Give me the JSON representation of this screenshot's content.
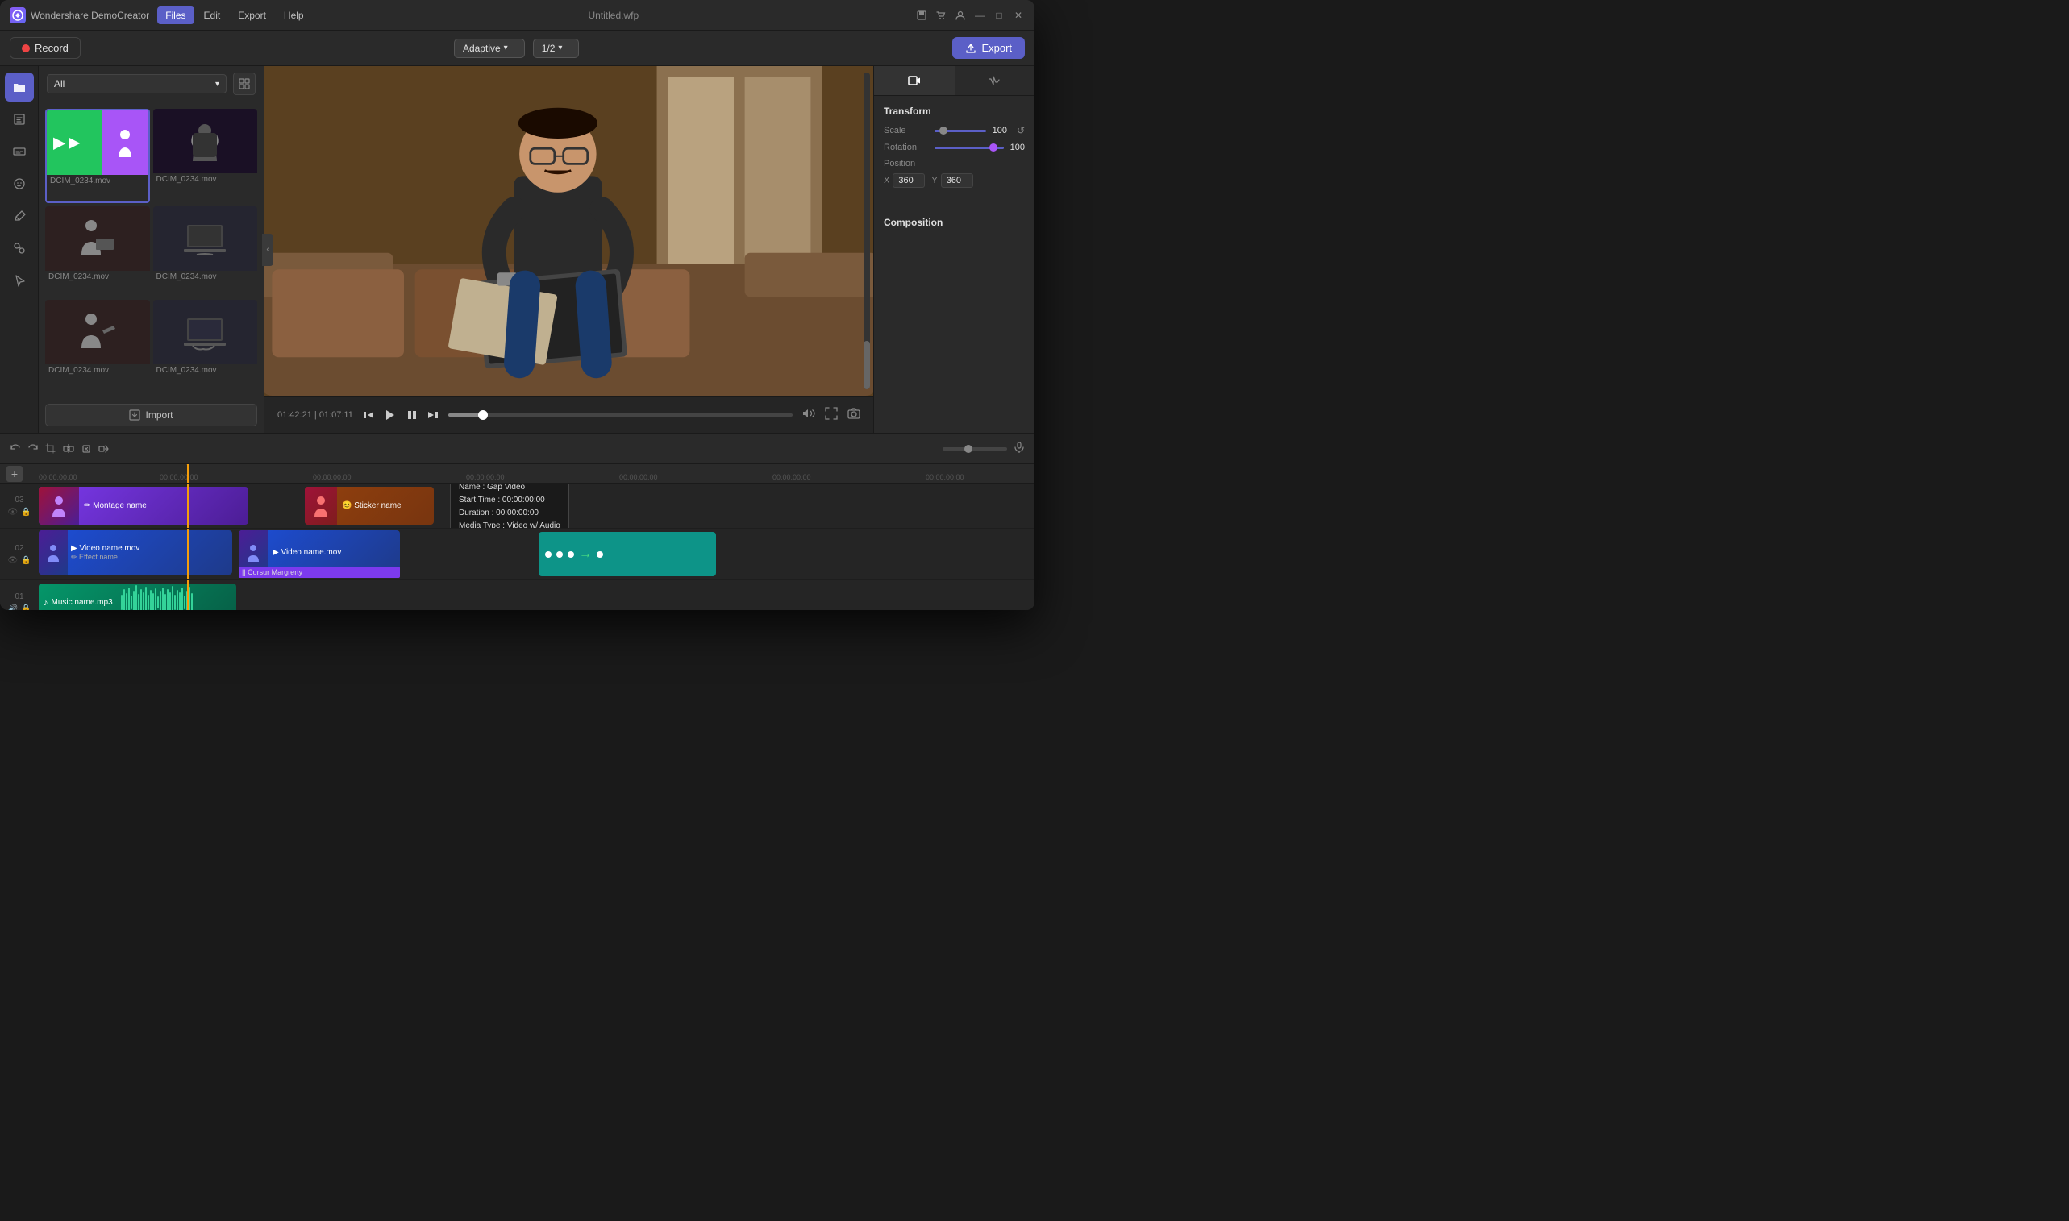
{
  "app": {
    "name": "Wondershare DemoCreator",
    "title": "Untitled.wfp",
    "logo_char": "w"
  },
  "menu": {
    "items": [
      "Files",
      "Edit",
      "Export",
      "Help"
    ],
    "active": "Files"
  },
  "toolbar": {
    "record_label": "Record",
    "quality_label": "Adaptive",
    "ratio_label": "1/2",
    "export_label": "Export"
  },
  "media_panel": {
    "filter_label": "All",
    "items": [
      {
        "name": "DCIM_0234.mov",
        "type": "green_person"
      },
      {
        "name": "DCIM_0234.mov",
        "type": "dark_laptop"
      },
      {
        "name": "DCIM_0234.mov",
        "type": "person_writing"
      },
      {
        "name": "DCIM_0234.mov",
        "type": "laptop_hands"
      },
      {
        "name": "DCIM_0234.mov",
        "type": "person_writing2"
      },
      {
        "name": "DCIM_0234.mov",
        "type": "laptop_hands2"
      }
    ],
    "import_label": "Import"
  },
  "playback": {
    "current_time": "01:42:21",
    "total_time": "01:07:11"
  },
  "right_panel": {
    "transform_title": "Transform",
    "scale_label": "Scale",
    "scale_value": "100",
    "rotation_label": "Rotation",
    "rotation_value": "100",
    "position_label": "Position",
    "x_label": "X",
    "x_value": "360",
    "y_label": "Y",
    "y_value": "360",
    "composition_title": "Composition"
  },
  "timeline": {
    "tracks": [
      {
        "id": "03",
        "clips": [
          {
            "label": "✏ Montage name",
            "type": "montage"
          },
          {
            "label": "😊 Sticker name",
            "type": "sticker"
          }
        ]
      },
      {
        "id": "02",
        "clips": [
          {
            "label": "▶ Video name.mov",
            "sublabel": "✏ Effect name",
            "type": "video1"
          },
          {
            "label": "▶ Video name.mov",
            "type": "video2"
          },
          {
            "label": "|| Cursur Margrerty",
            "type": "cursor"
          },
          {
            "label": "",
            "type": "teal"
          }
        ]
      },
      {
        "id": "01",
        "clips": [
          {
            "label": "♪ Music name.mp3",
            "type": "music"
          }
        ]
      }
    ],
    "ruler_ticks": [
      "00:00:00:00",
      "00:00:00:00",
      "00:00:00:00",
      "00:00:00:00",
      "00:00:00:00",
      "00:00:00:00",
      "00:00:00:00"
    ]
  },
  "tooltip": {
    "name_label": "Name :",
    "name_value": "Gap Video",
    "start_label": "Start Time :",
    "start_value": "00:00:00:00",
    "duration_label": "Duration :",
    "duration_value": "00:00:00:00",
    "media_label": "Media Type :",
    "media_value": "Video w/ Audio"
  },
  "title_bar_icons": {
    "minimize": "—",
    "maximize": "□",
    "close": "✕"
  }
}
